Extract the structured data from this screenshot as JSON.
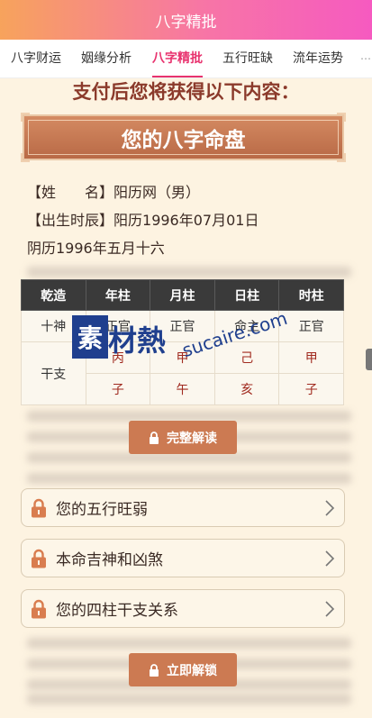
{
  "header": {
    "title": "八字精批"
  },
  "tabs": [
    {
      "label": "八字财运",
      "active": false
    },
    {
      "label": "姻缘分析",
      "active": false
    },
    {
      "label": "八字精批",
      "active": true
    },
    {
      "label": "五行旺缺",
      "active": false
    },
    {
      "label": "流年运势",
      "active": false
    }
  ],
  "notice": "支付后您将获得以下内容：",
  "banner": {
    "title": "您的八字命盘"
  },
  "profile": {
    "name_label": "【姓　　名】",
    "name_value": "阳历网（男）",
    "birth_label": "【出生时辰】",
    "birth_value": "阳历1996年07月01日",
    "lunar": "阴历1996年五月十六"
  },
  "bazi_table": {
    "headers": [
      "乾造",
      "年柱",
      "月柱",
      "日柱",
      "时柱"
    ],
    "shishen_label": "十神",
    "shishen": [
      "正官",
      "正官",
      "命主",
      "正官"
    ],
    "ganzhi_label": "干支",
    "gan": [
      "丙",
      "甲",
      "己",
      "甲"
    ],
    "zhi": [
      "子",
      "午",
      "亥",
      "子"
    ]
  },
  "watermark": {
    "logo": "素",
    "text": "材熱",
    "url": "sucaire.com"
  },
  "buttons": {
    "full_unlock": "完整解读",
    "unlock_now": "立即解锁"
  },
  "locked_items": [
    {
      "label": "您的五行旺弱"
    },
    {
      "label": "本命吉神和凶煞"
    },
    {
      "label": "您的四柱干支关系"
    }
  ],
  "colors": {
    "accent": "#e8326e",
    "button": "#cc7a52",
    "title": "#8b3a2b"
  }
}
